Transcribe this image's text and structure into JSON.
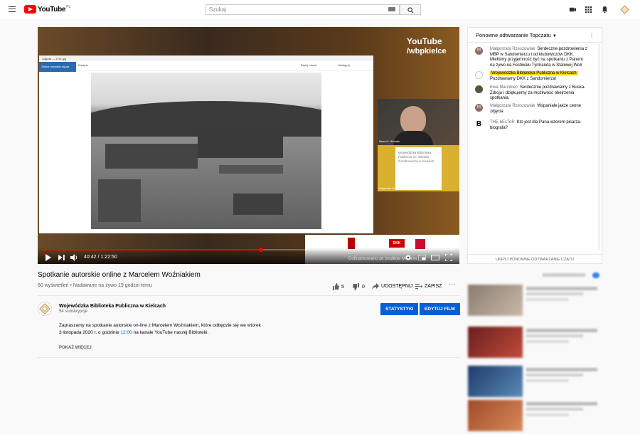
{
  "masthead": {
    "logo_text": "YouTube",
    "country_code": "PL",
    "search_placeholder": "Szukaj"
  },
  "player": {
    "overlay_logo_line1": "YouTube",
    "overlay_logo_line2": "/wbpkielce",
    "time_current": "40:42",
    "time_total": "1:22:50",
    "progress_fraction": 0.53,
    "banner_text": "Dofinansowano ze środków Ministra",
    "window_title": "Zdjęcia — 1711.jpg",
    "window_tab_label": "Zobacz wszystkie zdjęcia",
    "window_add_label": "Dodaj do",
    "window_edit_label": "Edytuj i utwórz",
    "window_share_label": "Udostępnij",
    "cam_name_label": "Marcel K. Woźniak",
    "cam_logo_text": "Wojewódzka Biblioteka Publiczna im. Witolda Gombrowicza w Kielcach",
    "participant_label": "Małgorzata Rzeszowiak"
  },
  "video": {
    "title": "Spotkanie autorskie online z Marcelem Woźniakiem",
    "views": "60 wyświetleń",
    "streamed": "Nadawane na żywo 19 godzin temu",
    "likes": "5",
    "dislikes": "0",
    "share_label": "UDOSTĘPNIJ",
    "save_label": "ZAPISZ"
  },
  "channel": {
    "name": "Wojewódzka Biblioteka Publiczna w Kielcach",
    "subs": "54 subskrypcje",
    "stats_button": "STATYSTYKI",
    "edit_button": "EDYTUJ FILM"
  },
  "description": {
    "line1": "Zapraszamy na spotkanie autorskie on-line z Marcelem Woźniakiem, które odbędzie się we wtorek",
    "line2_pre": "3 listopada 2020 r. o godzinie",
    "line2_link": "12:00",
    "line2_post": "na kanale YouTube naszej Biblioteki.",
    "show_more": "POKAŻ WIĘCEJ"
  },
  "chat": {
    "header": "Ponowne odtwarzanie Topczatu",
    "hide_label": "UKRYJ PONOWNE ODTWARZANIE CZATU",
    "messages": [
      {
        "author": "Małgorzata Rzeszowiak",
        "text": "Serdeczne pozdrowienia z MBP w Sandomierzu i od klubowiczów DKK. Mieliśmy przyjemność być na spotkaniu z Panem na żywo na Festiwalu Tyrmanda w Stalowej Woli",
        "avatar_letter": "M",
        "avatar_color": "#8d6e63"
      },
      {
        "author": "Wojewódzka Biblioteka Publiczna w Kielcach",
        "text": "Pozdrawiamy DKK z Sandomierza!",
        "avatar_letter": "",
        "avatar_color": "#ffffff"
      },
      {
        "author": "Ewa Marciniec",
        "text": "Serdecznie pozdrawiamy z Buska-Zdroju i dziękujemy za możliwość obejrzenia spotkania.",
        "avatar_letter": "",
        "avatar_color": "#4e5a3a"
      },
      {
        "author": "Małgorzata Rzeszowiak",
        "text": "Wspaniałe jakże cenne zdjęcia",
        "avatar_letter": "M",
        "avatar_color": "#8d6e63"
      },
      {
        "author": "THE bEsTeR",
        "text": "Kto jest dla Pana wzorem pisarza-biografa?",
        "avatar_letter": "B",
        "avatar_color": "#ffffff"
      }
    ]
  }
}
